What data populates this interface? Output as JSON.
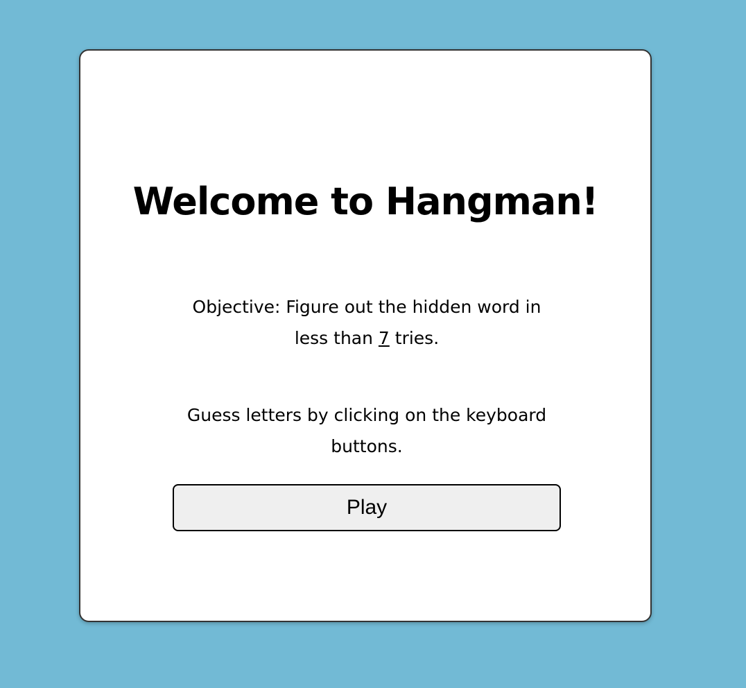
{
  "welcome": {
    "title": "Welcome to Hangman!",
    "objective_prefix": "Objective: Figure out the hidden word in less than ",
    "tries_count": "7",
    "objective_suffix": " tries.",
    "instructions": "Guess letters by clicking on the keyboard buttons.",
    "play_label": "Play"
  },
  "colors": {
    "background": "#72bad5",
    "card": "#ffffff",
    "button": "#efefef"
  }
}
